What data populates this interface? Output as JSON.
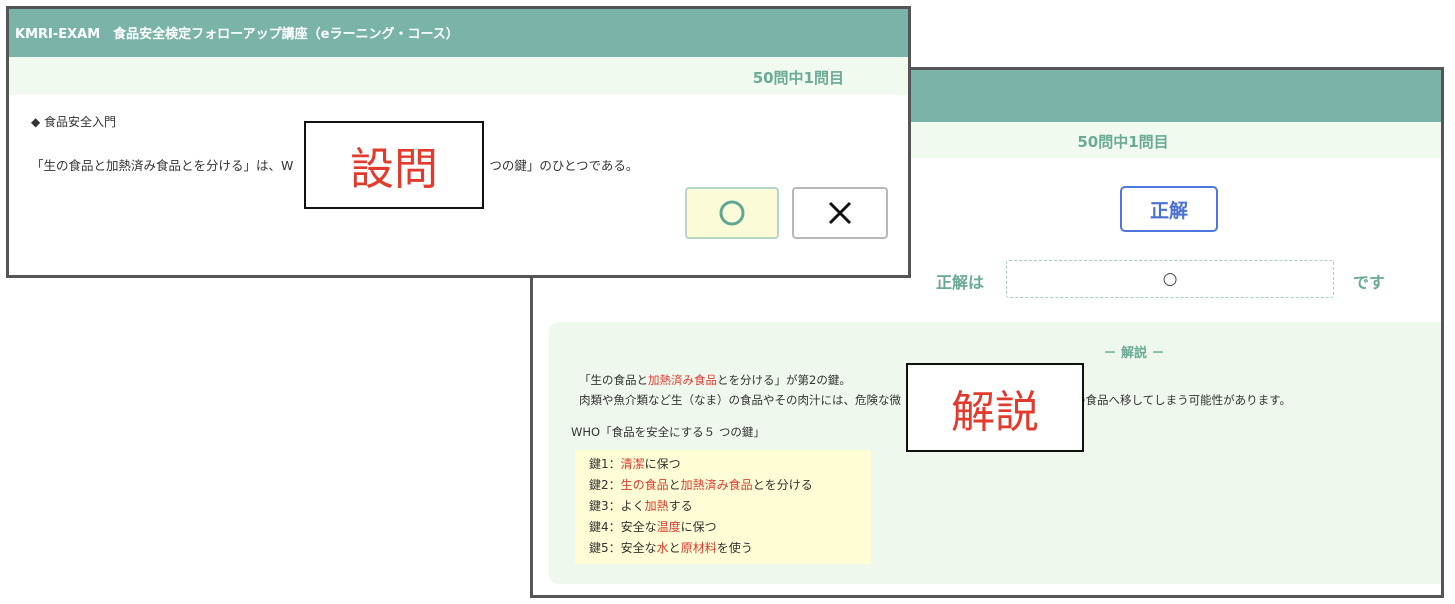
{
  "question_window": {
    "title": "KMRI-EXAM　食品安全検定フォローアップ講座（eラーニング・コース）",
    "progress": "50問中1問目",
    "category": "◆ 食品安全入門",
    "question_text_part1": "「生の食品と加熱済み食品とを分ける」は、W",
    "question_text_part2": "つの鍵」のひとつである。",
    "answer_true_icon": "circle-icon",
    "answer_false_icon": "cross-icon"
  },
  "explain_window": {
    "progress": "50問中1問目",
    "result_badge": "正解",
    "answer_label": "正解は",
    "answer_value": "○",
    "answer_suffix": "です",
    "explain_heading": "－ 解説 －",
    "line1_a": "「生の食品と",
    "line1_red": "加熱済み食品",
    "line1_b": "とを分ける」が第2の鍵。",
    "line2_a": "肉類や魚介類など生（なま）の食品やその肉汁には、危険な微",
    "line2_b": "、他の食品へ移してしまう可能性があります。",
    "who_title": "WHO「食品を安全にする５ つの鍵」",
    "keys": [
      {
        "prefix": "鍵1：",
        "parts": [
          {
            "t": "清潔",
            "red": true
          },
          {
            "t": "に保つ",
            "red": false
          }
        ]
      },
      {
        "prefix": "鍵2：",
        "parts": [
          {
            "t": "生の食品",
            "red": true
          },
          {
            "t": "と",
            "red": false
          },
          {
            "t": "加熱済み食品",
            "red": true
          },
          {
            "t": "とを分ける",
            "red": false
          }
        ]
      },
      {
        "prefix": "鍵3：",
        "parts": [
          {
            "t": "よく",
            "red": false
          },
          {
            "t": "加熱",
            "red": true
          },
          {
            "t": "する",
            "red": false
          }
        ]
      },
      {
        "prefix": "鍵4：",
        "parts": [
          {
            "t": "安全な",
            "red": false
          },
          {
            "t": "温度",
            "red": true
          },
          {
            "t": "に保つ",
            "red": false
          }
        ]
      },
      {
        "prefix": "鍵5：",
        "parts": [
          {
            "t": "安全な",
            "red": false
          },
          {
            "t": "水",
            "red": true
          },
          {
            "t": "と",
            "red": false
          },
          {
            "t": "原材料",
            "red": true
          },
          {
            "t": "を使う",
            "red": false
          }
        ]
      }
    ]
  },
  "overlays": {
    "question_label": "設問",
    "explain_label": "解説"
  },
  "colors": {
    "titlebar": "#7ab3a7",
    "band": "#f1faef",
    "accent_text": "#6aaa96",
    "highlight_red": "#e03a2f",
    "badge_blue": "#4e78e0"
  }
}
